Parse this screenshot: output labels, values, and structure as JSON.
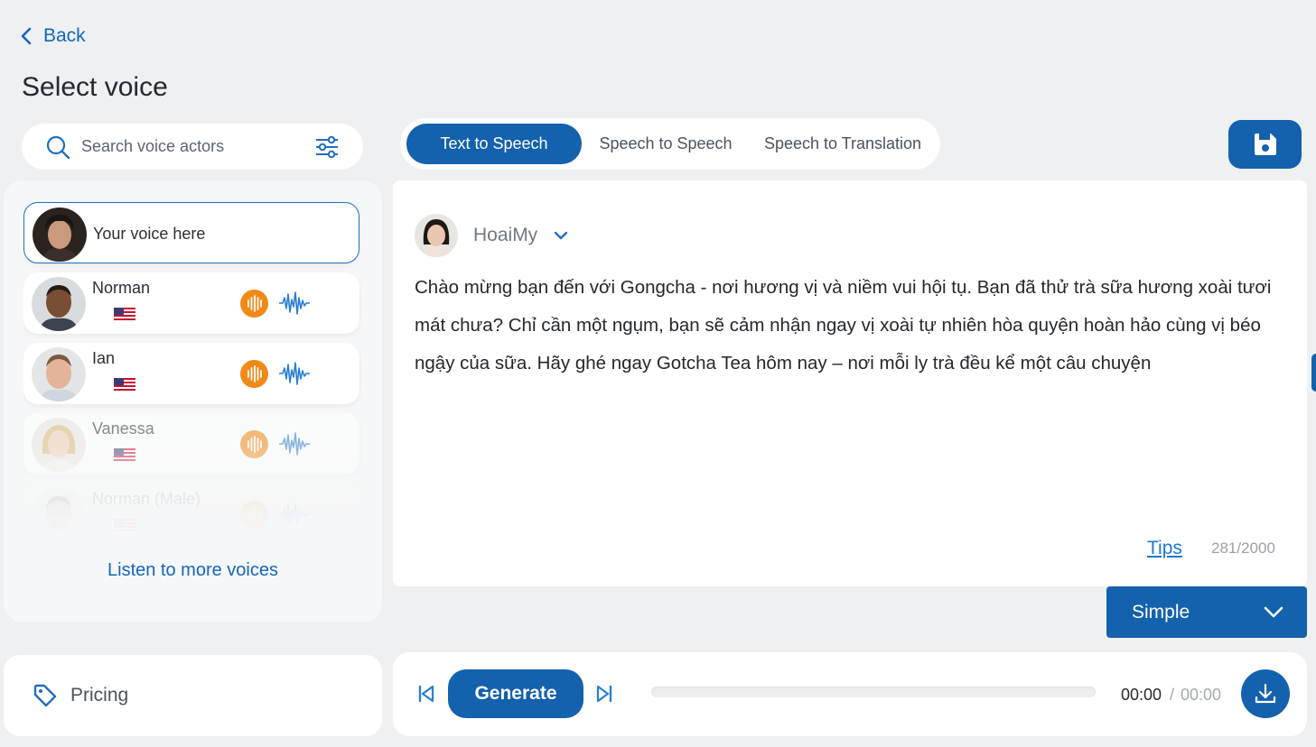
{
  "nav": {
    "back_label": "Back"
  },
  "page_title": "Select voice",
  "search": {
    "placeholder": "Search voice actors"
  },
  "voices": [
    {
      "name": "Your voice here",
      "selected": true
    },
    {
      "name": "Norman",
      "country": "US"
    },
    {
      "name": "Ian",
      "country": "US"
    },
    {
      "name": "Vanessa",
      "country": "US"
    },
    {
      "name": "Norman (Male)",
      "country": "US"
    }
  ],
  "more_voices_label": "Listen to more voices",
  "pricing_label": "Pricing",
  "tabs": [
    {
      "label": "Text to Speech",
      "active": true
    },
    {
      "label": "Speech to Speech"
    },
    {
      "label": "Speech to Translation"
    }
  ],
  "editor": {
    "speaker_name": "HoaiMy",
    "text": "Chào mừng bạn đến với Gongcha - nơi hương vị và niềm vui hội tụ. Bạn đã thử trà sữa hương xoài tươi mát chưa? Chỉ cần một ngụm, bạn sẽ cảm nhận ngay vị xoài tự nhiên hòa quyện hoàn hảo cùng vị béo ngậy của sữa. Hãy ghé ngay Gotcha Tea hôm nay – nơi mỗi ly trà đều kể một câu chuyện",
    "tips_label": "Tips",
    "char_count": "281/2000"
  },
  "mode": {
    "selected": "Simple"
  },
  "player": {
    "generate_label": "Generate",
    "current_time": "00:00",
    "separator": "/",
    "total_time": "00:00",
    "progress": 0
  },
  "colors": {
    "primary": "#1461ad",
    "accent_orange": "#ef8a17",
    "link": "#1565c0",
    "background": "#eef0f2"
  },
  "icons": {
    "back": "chevron-left-icon",
    "search": "search-icon",
    "filter": "filter-sliders-icon",
    "save": "floppy-disk-icon",
    "play": "audio-play-icon",
    "wave": "waveform-icon",
    "pricing": "price-tag-icon",
    "prev": "skip-previous-icon",
    "next": "skip-next-icon",
    "download": "download-icon"
  }
}
